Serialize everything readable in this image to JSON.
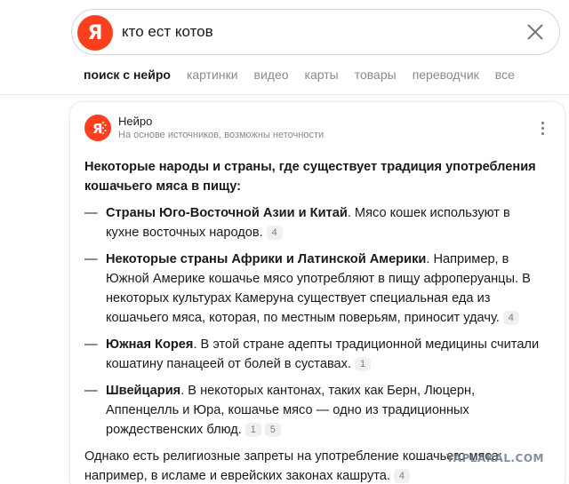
{
  "search": {
    "logo_letter": "Я",
    "query": "кто ест котов"
  },
  "tabs": [
    {
      "label": "поиск с нейро",
      "active": true
    },
    {
      "label": "картинки",
      "active": false
    },
    {
      "label": "видео",
      "active": false
    },
    {
      "label": "карты",
      "active": false
    },
    {
      "label": "товары",
      "active": false
    },
    {
      "label": "переводчик",
      "active": false
    },
    {
      "label": "все",
      "active": false
    }
  ],
  "answer": {
    "source_name": "Нейро",
    "source_subtitle": "На основе источников, возможны неточности",
    "intro": "Некоторые народы и страны, где существует традиция употребления кошачьего мяса в пищу:",
    "items": [
      {
        "bold": "Страны Юго-Восточной Азии и Китай",
        "text": ". Мясо кошек используют в кухне восточных народов.",
        "refs": [
          "4"
        ]
      },
      {
        "bold": "Некоторые страны Африки и Латинской Америки",
        "text": ". Например, в Южной Америке кошачье мясо употребляют в пищу афроперуанцы. В некоторых культурах Камеруна существует специальная еда из кошачьего мяса, которая, по местным поверьям, приносит удачу.",
        "refs": [
          "4"
        ]
      },
      {
        "bold": "Южная Корея",
        "text": ". В этой стране адепты традиционной медицины считали кошатину панацеей от болей в суставах.",
        "refs": [
          "1"
        ]
      },
      {
        "bold": "Швейцария",
        "text": ". В некоторых кантонах, таких как Берн, Люцерн, Аппенцелль и Юра, кошачье мясо — одно из традиционных рождественских блюд.",
        "refs": [
          "1",
          "5"
        ]
      }
    ],
    "outro": "Однако есть религиозные запреты на употребление кошачьего мяса: например, в исламе и еврейских законах кашрута.",
    "outro_refs": [
      "4"
    ]
  },
  "watermark": "YAPLAKAL.COM",
  "colors": {
    "brand": "#fc3f1d",
    "text": "#1a1a1a",
    "muted": "#8a8a8a"
  }
}
